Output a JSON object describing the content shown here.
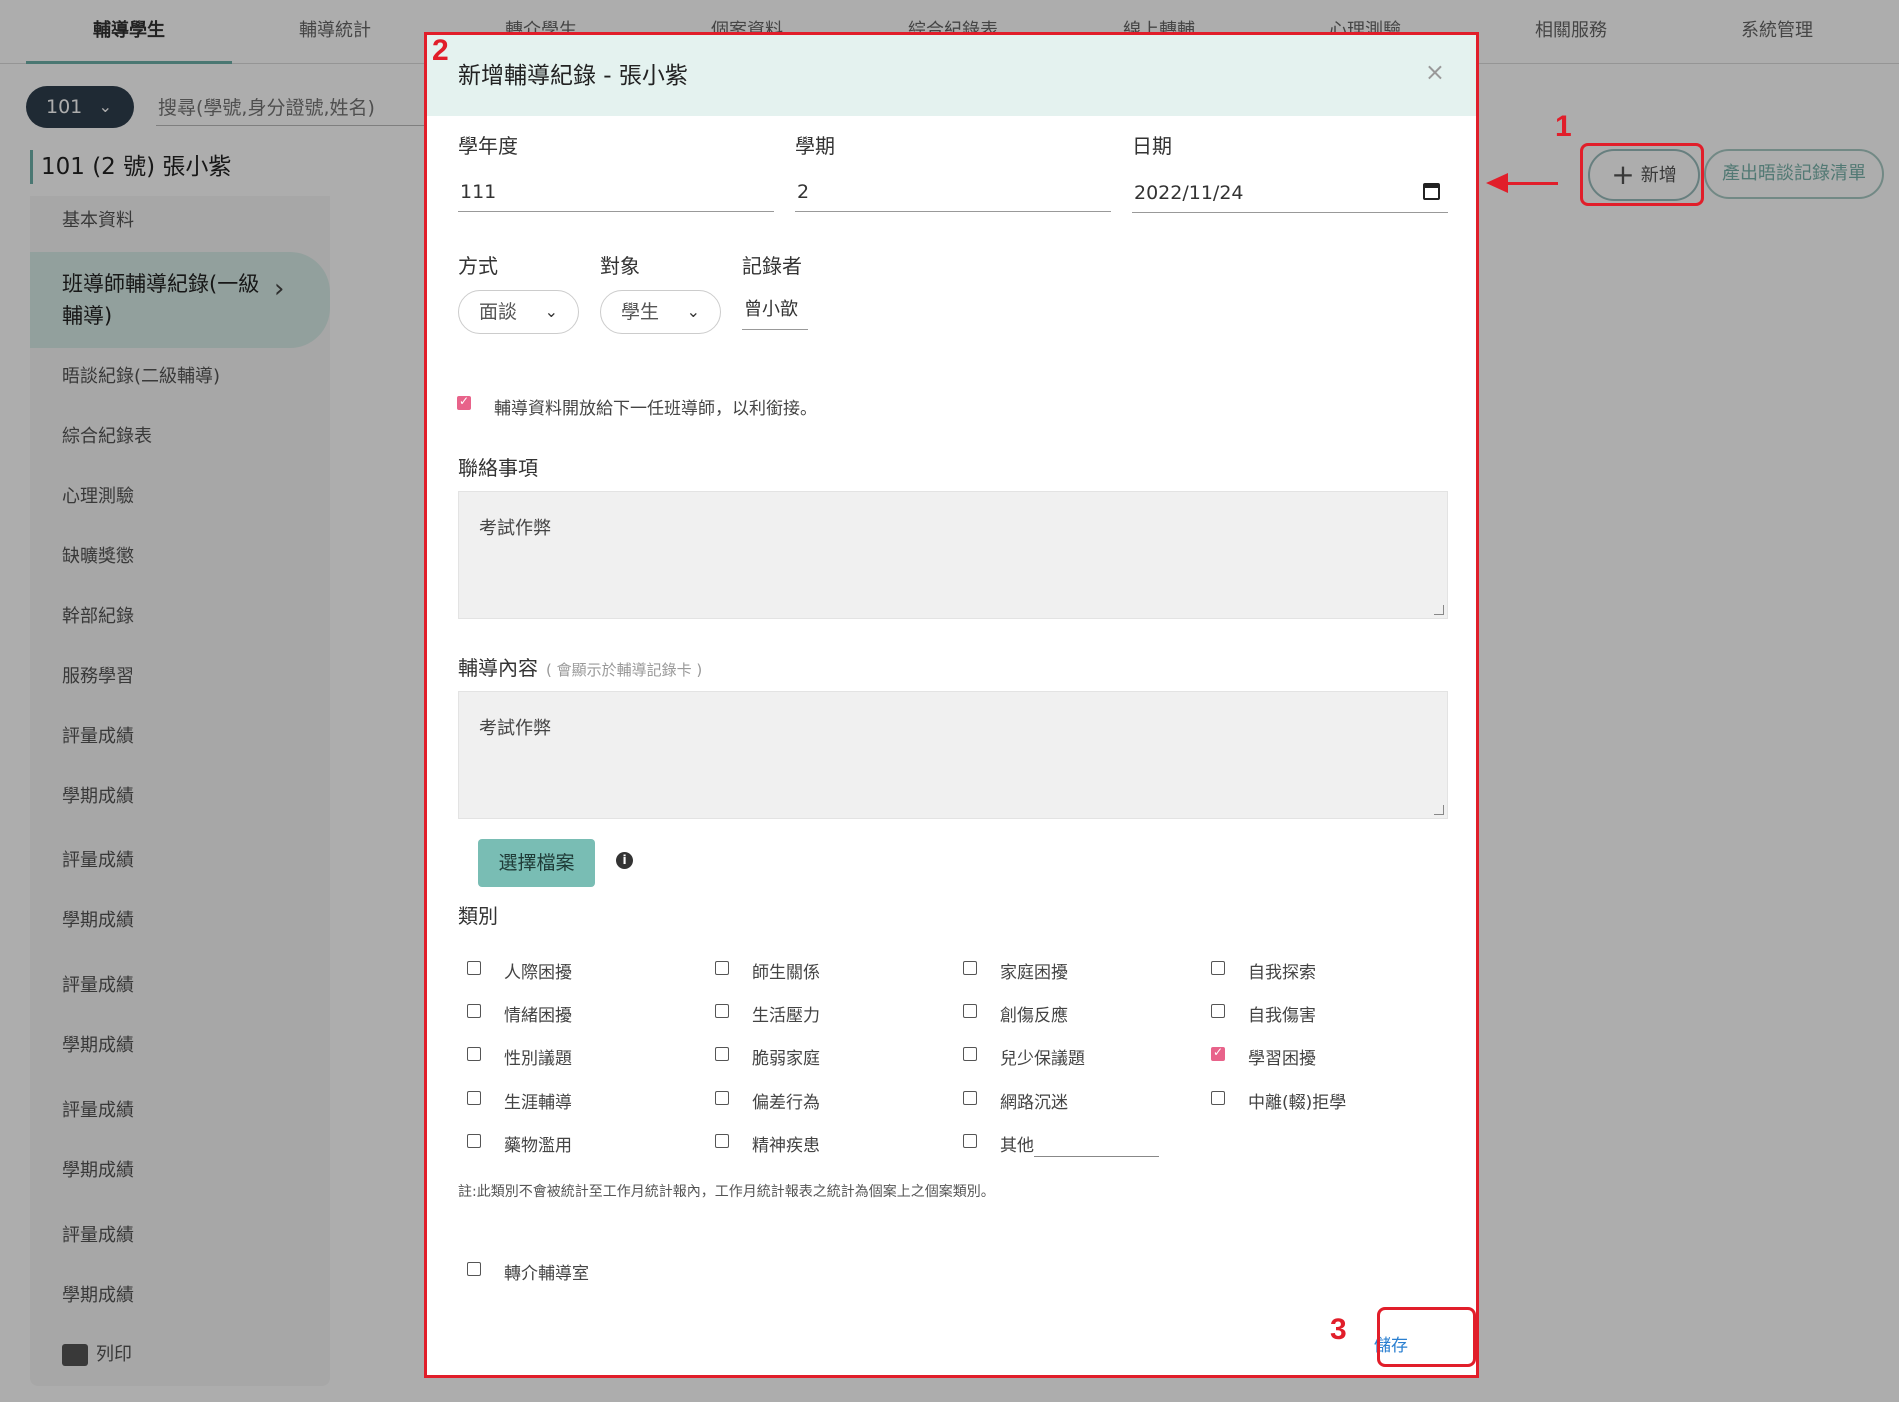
{
  "topnav": {
    "tabs": [
      {
        "label": "輔導學生",
        "active": true
      },
      {
        "label": "輔導統計"
      },
      {
        "label": "轉介學生"
      },
      {
        "label": "個案資料"
      },
      {
        "label": "綜合紀錄表"
      },
      {
        "label": "線上轉輔"
      },
      {
        "label": "心理測驗"
      },
      {
        "label": "相關服務"
      },
      {
        "label": "系統管理"
      }
    ]
  },
  "toolbar": {
    "class_select": "101",
    "search_placeholder": "搜尋(學號,身分證號,姓名)",
    "student_title": "101 (2 號) 張小紫",
    "add_label": "新增",
    "export_label": "產出晤談記錄清單"
  },
  "sidebar": {
    "items": [
      "基本資料",
      "班導師輔導紀錄(一級輔導)",
      "晤談紀錄(二級輔導)",
      "綜合紀錄表",
      "心理測驗",
      "缺曠獎懲",
      "幹部紀錄",
      "服務學習",
      "評量成績",
      "學期成績",
      "評量成績",
      "學期成績",
      "評量成績",
      "學期成績",
      "評量成績",
      "學期成績",
      "評量成績",
      "學期成績"
    ],
    "active_index": 1,
    "print_label": "列印"
  },
  "dialog": {
    "title": "新增輔導紀錄 - 張小紫",
    "close": "×",
    "year_label": "學年度",
    "year_value": "111",
    "term_label": "學期",
    "term_value": "2",
    "date_label": "日期",
    "date_value": "2022/11/24",
    "method_label": "方式",
    "method_value": "面談",
    "target_label": "對象",
    "target_value": "學生",
    "recorder_label": "記錄者",
    "recorder_value": "曾小歆",
    "share_label": "輔導資料開放給下一任班導師，以利銜接。",
    "share_checked": true,
    "contact_label": "聯絡事項",
    "contact_value": "考試作弊",
    "content_label": "輔導內容",
    "content_hint": "( 會顯示於輔導記錄卡 )",
    "content_value": "考試作弊",
    "file_button": "選擇檔案",
    "category_label": "類別",
    "categories": [
      {
        "label": "人際困擾",
        "checked": false
      },
      {
        "label": "師生關係",
        "checked": false
      },
      {
        "label": "家庭困擾",
        "checked": false
      },
      {
        "label": "自我探索",
        "checked": false
      },
      {
        "label": "情緒困擾",
        "checked": false
      },
      {
        "label": "生活壓力",
        "checked": false
      },
      {
        "label": "創傷反應",
        "checked": false
      },
      {
        "label": "自我傷害",
        "checked": false
      },
      {
        "label": "性別議題",
        "checked": false
      },
      {
        "label": "脆弱家庭",
        "checked": false
      },
      {
        "label": "兒少保議題",
        "checked": false
      },
      {
        "label": "學習困擾",
        "checked": true
      },
      {
        "label": "生涯輔導",
        "checked": false
      },
      {
        "label": "偏差行為",
        "checked": false
      },
      {
        "label": "網路沉迷",
        "checked": false
      },
      {
        "label": "中離(輟)拒學",
        "checked": false
      },
      {
        "label": "藥物濫用",
        "checked": false
      },
      {
        "label": "精神疾患",
        "checked": false
      },
      {
        "label": "其他",
        "checked": false
      }
    ],
    "note": "註:此類別不會被統計至工作月統計報內，工作月統計報表之統計為個案上之個案類別。",
    "referral_label": "轉介輔導室",
    "referral_checked": false,
    "save_label": "儲存"
  },
  "annotations": {
    "n1": "1",
    "n2": "2",
    "n3": "3",
    "color": "#e11e2a"
  }
}
